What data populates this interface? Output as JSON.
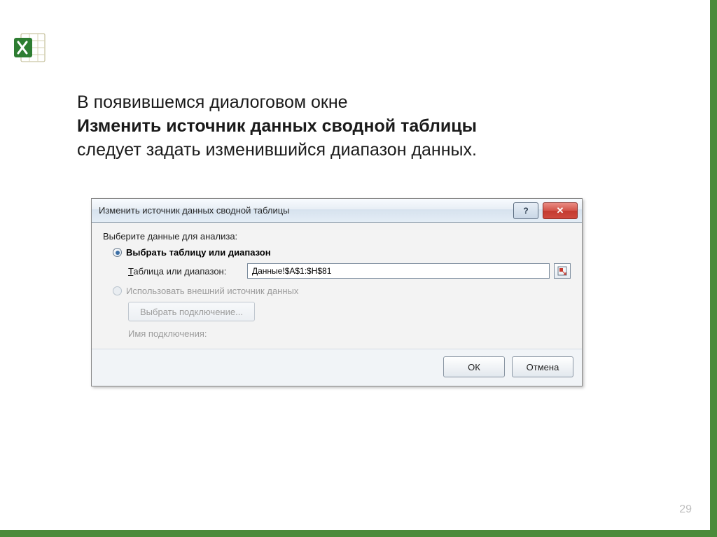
{
  "slide": {
    "text_line1": "В появившемся диалоговом окне",
    "text_bold": "Изменить источник данных сводной таблицы",
    "text_line3": "следует задать изменившийся диапазон данных.",
    "page_number": "29"
  },
  "dialog": {
    "title": "Изменить источник данных сводной таблицы",
    "help_symbol": "?",
    "close_symbol": "✕",
    "section_label": "Выберите данные для анализа:",
    "radio1_label": "Выбрать таблицу или диапазон",
    "field_label_prefix": "Т",
    "field_label_rest": "аблица или диапазон:",
    "range_value": "Данные!$A$1:$H$81",
    "radio2_label": "Использовать внешний источник данных",
    "choose_connection": "Выбрать подключение...",
    "connection_name_label": "Имя подключения:",
    "ok": "ОК",
    "cancel": "Отмена"
  }
}
